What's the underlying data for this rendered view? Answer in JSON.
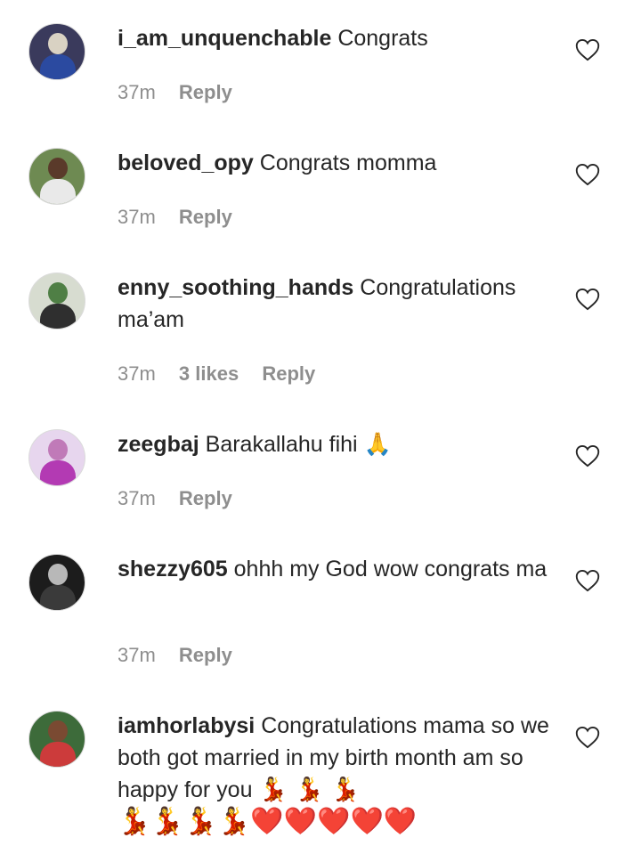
{
  "comments": [
    {
      "username": "i_am_unquenchable",
      "text": "Congrats",
      "time": "37m",
      "likes": "",
      "reply_label": "Reply",
      "avatar_icon": "user-avatar-icon",
      "avatar_colors": {
        "bg": "#3a3a5c",
        "head": "#d9d2c3",
        "body": "#2b4aa0"
      }
    },
    {
      "username": "beloved_opy",
      "text": "Congrats momma",
      "time": "37m",
      "likes": "",
      "reply_label": "Reply",
      "avatar_icon": "user-avatar-icon",
      "avatar_colors": {
        "bg": "#6e8a52",
        "head": "#5a3a2a",
        "body": "#e9e9e9"
      }
    },
    {
      "username": "enny_soothing_hands",
      "text": "Congratulations ma’am",
      "time": "37m",
      "likes": "3 likes",
      "reply_label": "Reply",
      "avatar_icon": "user-avatar-icon",
      "avatar_colors": {
        "bg": "#d7dcd0",
        "head": "#4f7f45",
        "body": "#2f2f2f"
      }
    },
    {
      "username": "zeegbaj",
      "text": "Barakallahu fihi",
      "emoji": "🙏",
      "time": "37m",
      "likes": "",
      "reply_label": "Reply",
      "avatar_icon": "user-avatar-icon",
      "avatar_colors": {
        "bg": "#e7d6ee",
        "head": "#c07ab8",
        "body": "#b33ab3"
      }
    },
    {
      "username": "shezzy605",
      "text": "ohhh my God wow congrats ma",
      "time": "37m",
      "likes": "",
      "reply_label": "Reply",
      "avatar_icon": "user-avatar-icon",
      "avatar_colors": {
        "bg": "#1c1c1c",
        "head": "#b8b8b8",
        "body": "#3a3a3a"
      }
    },
    {
      "username": "iamhorlabysi",
      "text": "Congratulations mama so we both got married in my birth month am so happy for you",
      "emoji_inline": "💃 💃 💃",
      "emoji_line": "💃💃💃💃❤️❤️❤️❤️❤️",
      "time": "",
      "likes": "",
      "reply_label": "",
      "avatar_icon": "user-avatar-icon",
      "avatar_colors": {
        "bg": "#3d6b3a",
        "head": "#7a4a32",
        "body": "#cc3b3b"
      }
    }
  ],
  "heart_icon": "heart-outline-icon",
  "colors": {
    "text": "#262626",
    "meta": "#8e8e8e",
    "heart_stroke": "#262626",
    "emoji_heart": "#d9141e"
  }
}
